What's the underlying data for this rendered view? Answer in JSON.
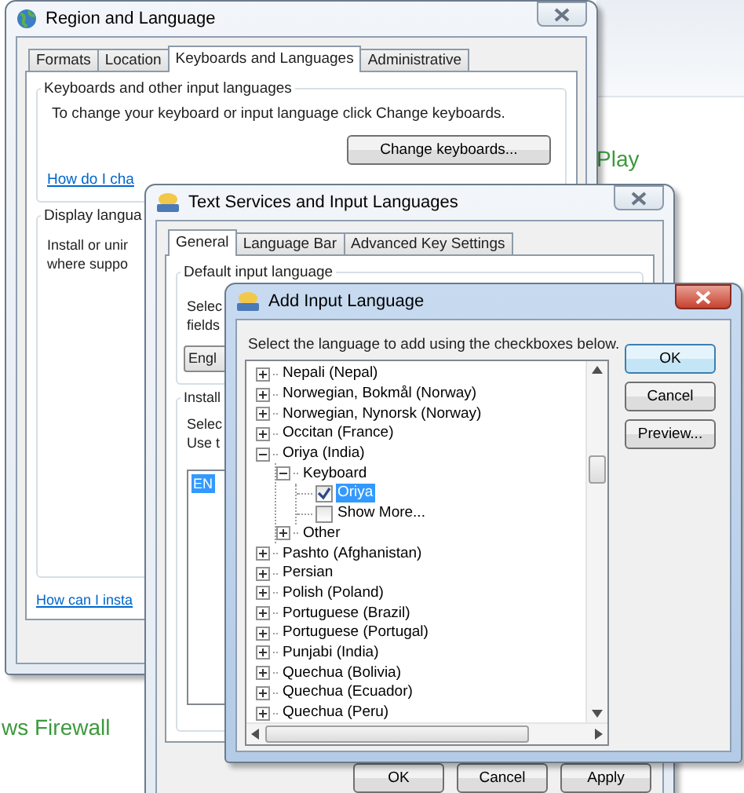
{
  "background": {
    "texts": [
      {
        "text": "Play"
      },
      {
        "text": "ws Firewall"
      }
    ]
  },
  "region_window": {
    "title": "Region and Language",
    "tabs": [
      {
        "label": "Formats",
        "selected": false
      },
      {
        "label": "Location",
        "selected": false
      },
      {
        "label": "Keyboards and Languages",
        "selected": true
      },
      {
        "label": "Administrative",
        "selected": false
      }
    ],
    "keyboards_group": {
      "legend": "Keyboards and other input languages",
      "text": "To change your keyboard or input language click Change keyboards.",
      "button": "Change keyboards...",
      "link": "How do I cha"
    },
    "display_group": {
      "legend": "Display langua",
      "lines": [
        "Install or unir",
        "where suppo"
      ]
    },
    "link": "How can I insta"
  },
  "text_services_window": {
    "title": "Text Services and Input Languages",
    "tabs": [
      {
        "label": "General",
        "selected": true
      },
      {
        "label": "Language Bar",
        "selected": false
      },
      {
        "label": "Advanced Key Settings",
        "selected": false
      }
    ],
    "default_group": {
      "legend": "Default input language",
      "lines": [
        "Selec",
        "fields"
      ],
      "dropdown": "Engl"
    },
    "installed_group": {
      "legend": "Install",
      "lines": [
        "Selec",
        "Use t"
      ],
      "list": [
        {
          "label": "EN",
          "selected": true
        }
      ]
    },
    "buttons": [
      "OK",
      "Cancel",
      "Apply"
    ]
  },
  "add_language_window": {
    "title": "Add Input Language",
    "instruction": "Select the language to add using the checkboxes below.",
    "tree": [
      {
        "kind": "node",
        "label": "Nepali (Nepal)",
        "expanded": false
      },
      {
        "kind": "node",
        "label": "Norwegian, Bokmål (Norway)",
        "expanded": false
      },
      {
        "kind": "node",
        "label": "Norwegian, Nynorsk (Norway)",
        "expanded": false
      },
      {
        "kind": "node",
        "label": "Occitan (France)",
        "expanded": false
      },
      {
        "kind": "node",
        "label": "Oriya (India)",
        "expanded": true,
        "children": [
          {
            "kind": "node",
            "label": "Keyboard",
            "expanded": true,
            "children": [
              {
                "kind": "checkbox",
                "label": "Oriya",
                "checked": true,
                "selected": true
              },
              {
                "kind": "checkbox",
                "label": "Show More...",
                "checked": false,
                "selected": false
              }
            ]
          },
          {
            "kind": "node",
            "label": "Other",
            "expanded": false
          }
        ]
      },
      {
        "kind": "node",
        "label": "Pashto (Afghanistan)",
        "expanded": false
      },
      {
        "kind": "node",
        "label": "Persian",
        "expanded": false
      },
      {
        "kind": "node",
        "label": "Polish (Poland)",
        "expanded": false
      },
      {
        "kind": "node",
        "label": "Portuguese (Brazil)",
        "expanded": false
      },
      {
        "kind": "node",
        "label": "Portuguese (Portugal)",
        "expanded": false
      },
      {
        "kind": "node",
        "label": "Punjabi (India)",
        "expanded": false
      },
      {
        "kind": "node",
        "label": "Quechua (Bolivia)",
        "expanded": false
      },
      {
        "kind": "node",
        "label": "Quechua (Ecuador)",
        "expanded": false
      },
      {
        "kind": "node",
        "label": "Quechua (Peru)",
        "expanded": false
      }
    ],
    "buttons": [
      "OK",
      "Cancel",
      "Preview..."
    ]
  }
}
